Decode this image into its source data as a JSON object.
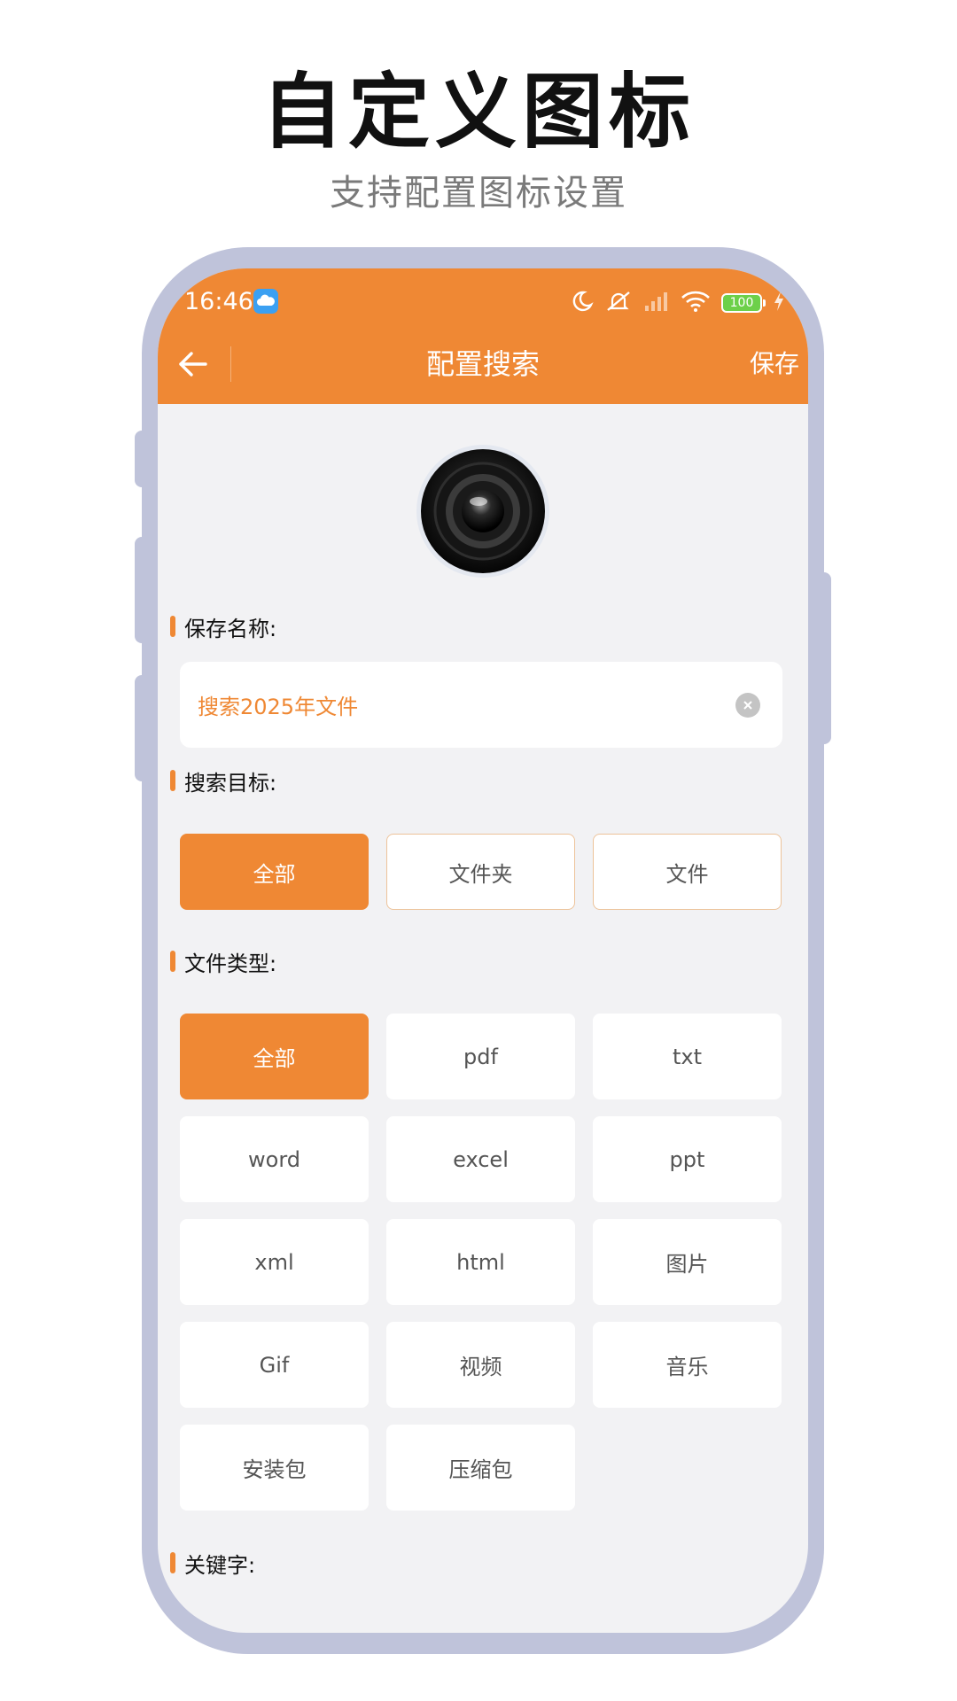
{
  "promo": {
    "title": "自定义图标",
    "subtitle": "支持配置图标设置"
  },
  "status_bar": {
    "time": "16:46",
    "battery": "100",
    "icons": [
      "cloud-icon",
      "moon-icon",
      "mute-icon",
      "signal-icon",
      "wifi-icon",
      "battery-icon",
      "charging-icon"
    ]
  },
  "appbar": {
    "title": "配置搜索",
    "save_label": "保存"
  },
  "sections": {
    "name_label": "保存名称:",
    "target_label": "搜索目标:",
    "type_label": "文件类型:",
    "keyword_label": "关键字:"
  },
  "name_input": {
    "value": "搜索2025年文件"
  },
  "targets": [
    {
      "label": "全部",
      "selected": true
    },
    {
      "label": "文件夹",
      "selected": false
    },
    {
      "label": "文件",
      "selected": false
    }
  ],
  "file_types": [
    {
      "label": "全部",
      "selected": true
    },
    {
      "label": "pdf",
      "selected": false
    },
    {
      "label": "txt",
      "selected": false
    },
    {
      "label": "word",
      "selected": false
    },
    {
      "label": "excel",
      "selected": false
    },
    {
      "label": "ppt",
      "selected": false
    },
    {
      "label": "xml",
      "selected": false
    },
    {
      "label": "html",
      "selected": false
    },
    {
      "label": "图片",
      "selected": false
    },
    {
      "label": "Gif",
      "selected": false
    },
    {
      "label": "视频",
      "selected": false
    },
    {
      "label": "音乐",
      "selected": false
    },
    {
      "label": "安装包",
      "selected": false
    },
    {
      "label": "压缩包",
      "selected": false
    }
  ],
  "colors": {
    "accent": "#ef8834",
    "frame": "#bfc3da",
    "screen_bg": "#f2f2f4"
  }
}
